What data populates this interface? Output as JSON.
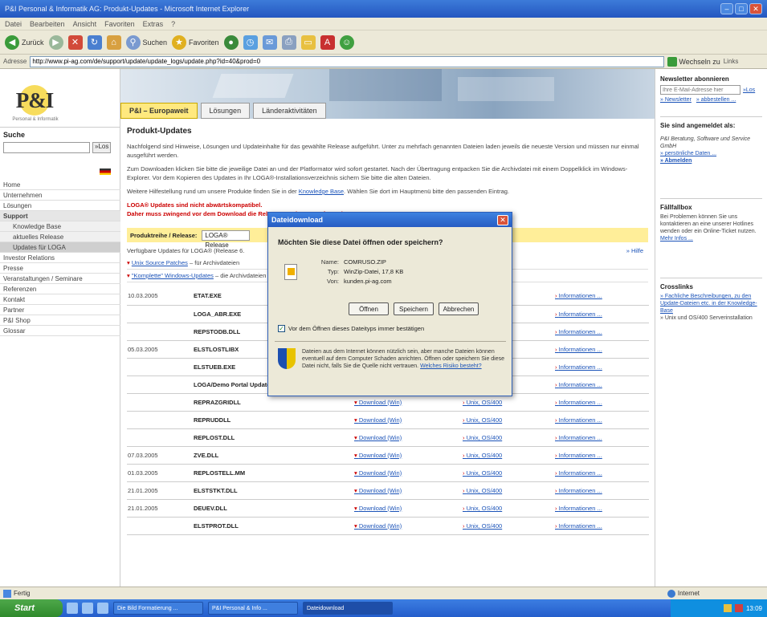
{
  "browser": {
    "title": "P&I Personal & Informatik AG: Produkt-Updates - Microsoft Internet Explorer",
    "menu": [
      "Datei",
      "Bearbeiten",
      "Ansicht",
      "Favoriten",
      "Extras",
      "?"
    ],
    "toolbar": {
      "back": "Zurück",
      "search": "Suchen",
      "favorites": "Favoriten"
    },
    "address_label": "Adresse",
    "address": "http://www.pi-ag.com/de/support/update/update_logs/update.php?id=40&prod=0",
    "go": "Wechseln zu",
    "links": "Links"
  },
  "page": {
    "logo": {
      "text": "P&I",
      "subtitle": "Personal & Informatik"
    },
    "search": {
      "title": "Suche",
      "ok": "»Los"
    },
    "nav": [
      {
        "label": "Home",
        "type": ""
      },
      {
        "label": "Unternehmen",
        "type": ""
      },
      {
        "label": "Lösungen",
        "type": ""
      },
      {
        "label": "Support",
        "type": "head"
      },
      {
        "label": "Knowledge Base",
        "type": "sub"
      },
      {
        "label": "aktuelles Release",
        "type": "sub"
      },
      {
        "label": "Updates für LOGA",
        "type": "sub active"
      },
      {
        "label": "Investor Relations",
        "type": ""
      },
      {
        "label": "Presse",
        "type": ""
      },
      {
        "label": "Veranstaltungen / Seminare",
        "type": ""
      },
      {
        "label": "Referenzen",
        "type": ""
      },
      {
        "label": "Kontakt",
        "type": ""
      },
      {
        "label": "Partner",
        "type": ""
      },
      {
        "label": "P&I Shop",
        "type": ""
      },
      {
        "label": "Glossar",
        "type": ""
      }
    ],
    "tabs": [
      "P&I – Europaweit",
      "Lösungen",
      "Länderaktivitäten"
    ],
    "title": "Produkt-Updates",
    "paragraphs": [
      "Nachfolgend sind Hinweise, Lösungen und Updateinhalte für das gewählte Release aufgeführt. Unter zu mehrfach genannten Dateien laden jeweils die neueste Version und müssen nur einmal ausgeführt werden.",
      "Zum Downloaden klicken Sie bitte die jeweilige Datei an und der Platformator wird sofort gestartet. Nach der Übertragung entpacken Sie die Archivdatei mit einem Doppelklick im Windows-Explorer. Vor dem Kopieren des Updates in Ihr LOGA®-Installationsverzeichnis sichern Sie bitte die alten Dateien.",
      "Weitere Hilfestellung rund um unsere Produkte finden Sie in der"
    ],
    "kb_link": "Knowledge Base",
    "kb_suffix": ". Wählen Sie dort im Hauptmenü bitte den passenden Eintrag.",
    "warning": [
      "LOGA® Updates sind nicht abwärtskompatibel.",
      "Daher muss zwingend vor dem Download die Release-Version geprüft werden."
    ],
    "product_label": "Produktreihe / Release:",
    "product_value": "LOGA® Release",
    "available_text": "Verfügbare Updates für LOGA® (Release 6.",
    "help": "» Hilfe",
    "tree": [
      {
        "link": "Unix Source Patches",
        "rest": " – für Archivdateien"
      },
      {
        "link": "\"Komplette\" Windows-Updates",
        "rest": " – die Archivdateien enthalten Dateien ...                         (EXE, SCOUT.EXE)"
      }
    ],
    "table": [
      {
        "date": "10.03.2005",
        "file": "ETAT.EXE",
        "dl": "",
        "unix": "",
        "info": "Informationen ..."
      },
      {
        "date": "",
        "file": "LOGA_ABR.EXE",
        "dl": "",
        "unix": "",
        "info": "Informationen ..."
      },
      {
        "date": "",
        "file": "REPSTODB.DLL",
        "dl": "",
        "unix": "",
        "info": "Informationen ..."
      },
      {
        "date": "05.03.2005",
        "file": "ELSTLOSTLIBX",
        "dl": "",
        "unix": "",
        "info": "Informationen ..."
      },
      {
        "date": "",
        "file": "ELSTUEB.EXE",
        "dl": "Download (Win)",
        "unix": "Unix, OS/400",
        "info": "Informationen ..."
      },
      {
        "date": "",
        "file": "LOGA/Demo Portal Update",
        "dl": "Download (Win)",
        "unix": "",
        "info": "Informationen ..."
      },
      {
        "date": "",
        "file": "REPRAZGRIDLL",
        "dl": "Download (Win)",
        "unix": "Unix, OS/400",
        "info": "Informationen ..."
      },
      {
        "date": "",
        "file": "REPRUDDLL",
        "dl": "Download (Win)",
        "unix": "Unix, OS/400",
        "info": "Informationen ..."
      },
      {
        "date": "",
        "file": "REPLOST.DLL",
        "dl": "Download (Win)",
        "unix": "Unix, OS/400",
        "info": "Informationen ..."
      },
      {
        "date": "07.03.2005",
        "file": "ZVE.DLL",
        "dl": "Download (Win)",
        "unix": "Unix, OS/400",
        "info": "Informationen ..."
      },
      {
        "date": "01.03.2005",
        "file": "REPLOSTELL.MM",
        "dl": "Download (Win)",
        "unix": "Unix, OS/400",
        "info": "Informationen ..."
      },
      {
        "date": "21.01.2005",
        "file": "ELSTSTKT.DLL",
        "dl": "Download (Win)",
        "unix": "Unix, OS/400",
        "info": "Informationen ..."
      },
      {
        "date": "21.01.2005",
        "file": "DEUEV.DLL",
        "dl": "Download (Win)",
        "unix": "Unix, OS/400",
        "info": "Informationen ..."
      },
      {
        "date": "",
        "file": "ELSTPROT.DLL",
        "dl": "Download (Win)",
        "unix": "Unix, OS/400",
        "info": "Informationen ..."
      }
    ],
    "right": {
      "newsletter_title": "Newsletter abonnieren",
      "newsletter_placeholder": "Ihre E-Mail-Adresse hier",
      "newsletter_ok": "»Los",
      "newsletter_links": [
        "» Newsletter",
        "» abbestellen ..."
      ],
      "login_title": "Sie sind angemeldet als:",
      "login_text": "P&I Beratung, Software und Service GmbH",
      "login_links": [
        "» persönliche Daten ...",
        "» Abmelden"
      ],
      "hotline_title": "Fällfallbox",
      "hotline_text": "Bei Problemen können Sie uns kontaktieren an eine unserer Hotlines wenden oder ein Online-Ticket nutzen.",
      "hotline_link": "Mehr Infos ...",
      "crosslinks_title": "Crosslinks",
      "crosslinks": [
        "» Fachliche Beschreibungen, zu den Update-Dateien etc. in der Knowledge-Base",
        "» Unix und OS/400 Serverinstallation"
      ]
    }
  },
  "dialog": {
    "title": "Dateidownload",
    "question": "Möchten Sie diese Datei öffnen oder speichern?",
    "name_label": "Name:",
    "name": "COMRUSO.ZIP",
    "type_label": "Typ:",
    "type": "WinZip-Datei, 17,8 KB",
    "from_label": "Von:",
    "from": "kunden.pi-ag.com",
    "buttons": [
      "Öffnen",
      "Speichern",
      "Abbrechen"
    ],
    "checkbox": "Vor dem Öffnen dieses Dateityps immer bestätigen",
    "warning": "Dateien aus dem Internet können nützlich sein, aber manche Dateien können eventuell auf dem Computer Schaden anrichten. Öffnen oder speichern Sie diese Datei nicht, falls Sie die Quelle nicht vertrauen.",
    "warning_link": "Welches Risiko besteht?"
  },
  "status": {
    "left": "Fertig",
    "zone": "Internet"
  },
  "taskbar": {
    "start": "Start",
    "tasks": [
      "Die Bild Formatierung ...",
      "P&I Personal & Info ...",
      "Dateidownload"
    ],
    "clock": "13:09"
  }
}
